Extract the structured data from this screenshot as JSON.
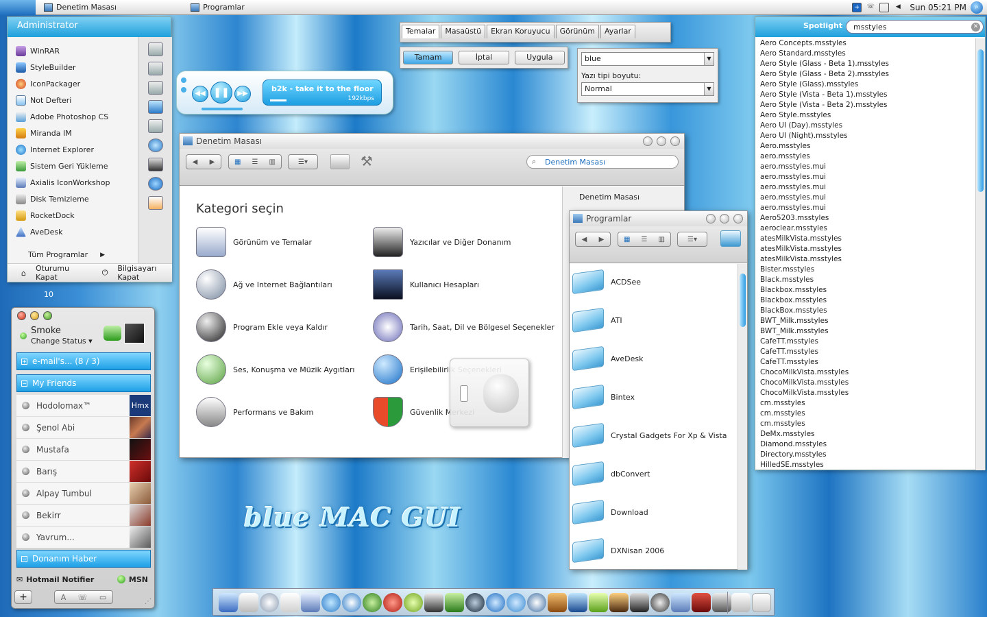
{
  "menubar": {
    "window_items": [
      "Denetim Masası",
      "Programlar"
    ],
    "clock": "Sun 05:21 PM"
  },
  "start_menu": {
    "user": "Administrator",
    "items": [
      "WinRAR",
      "StyleBuilder",
      "IconPackager",
      "Not Defteri",
      "Adobe Photoshop CS",
      "Miranda IM",
      "Internet Explorer",
      "Sistem Geri Yükleme",
      "Axialis IconWorkshop",
      "Disk Temizleme",
      "RocketDock",
      "AveDesk"
    ],
    "all_programs": "Tüm Programlar",
    "logoff": "Oturumu Kapat",
    "shutdown": "Bilgisayarı Kapat",
    "badge": "10"
  },
  "display_dialog": {
    "tabs": [
      "Temalar",
      "Masaüstü",
      "Ekran Koruyucu",
      "Görünüm",
      "Ayarlar"
    ],
    "buttons": [
      "Tamam",
      "İptal",
      "Uygula"
    ],
    "theme_value": "blue",
    "font_size_label": "Yazı tipi boyutu:",
    "font_size_value": "Normal"
  },
  "player": {
    "track": "b2k - take it to the floor",
    "bitrate": "192kbps"
  },
  "control_panel": {
    "title": "Denetim Masası",
    "search_placeholder": "Denetim Masası",
    "heading": "Kategori seçin",
    "side_title": "Denetim Masası",
    "categories": [
      "Görünüm ve Temalar",
      "Yazıcılar ve Diğer Donanım",
      "Ağ ve Internet Bağlantıları",
      "Kullanıcı Hesapları",
      "Program Ekle veya Kaldır",
      "Tarih, Saat, Dil ve Bölgesel Seçenekler",
      "Ses, Konuşma ve Müzik Aygıtları",
      "Erişilebilirlik Seçenekleri",
      "Performans ve Bakım",
      "Güvenlik Merkezi"
    ]
  },
  "programs_window": {
    "title": "Programlar",
    "folders": [
      "ACDSee",
      "ATI",
      "AveDesk",
      "Bintex",
      "Crystal Gadgets For Xp & Vista",
      "dbConvert",
      "Download",
      "DXNisan 2006"
    ]
  },
  "spotlight": {
    "label": "Spotlight",
    "query": "msstyles",
    "results": [
      "Aero Concepts.msstyles",
      "Aero Standard.msstyles",
      "Aero Style (Glass - Beta 1).msstyles",
      "Aero Style (Glass - Beta 2).msstyles",
      "Aero Style (Glass).msstyles",
      "Aero Style (Vista - Beta 1).msstyles",
      "Aero Style (Vista - Beta 2).msstyles",
      "Aero Style.msstyles",
      "Aero UI (Day).msstyles",
      "Aero UI (Night).msstyles",
      "Aero.msstyles",
      "aero.msstyles",
      "aero.msstyles.mui",
      "aero.msstyles.mui",
      "aero.msstyles.mui",
      "aero.msstyles.mui",
      "aero.msstyles.mui",
      "Aero5203.msstyles",
      "aeroclear.msstyles",
      "atesMilkVista.msstyles",
      "atesMilkVista.msstyles",
      "atesMilkVista.msstyles",
      "Bister.msstyles",
      "Black.msstyles",
      "Blackbox.msstyles",
      "Blackbox.msstyles",
      "BlackBox.msstyles",
      "BWT_Milk.msstyles",
      "BWT_Milk.msstyles",
      "CafeTT.msstyles",
      "CafeTT.msstyles",
      "CafeTT.msstyles",
      "ChocoMilkVista.msstyles",
      "ChocoMilkVista.msstyles",
      "ChocoMilkVista.msstyles",
      "cm.msstyles",
      "cm.msstyles",
      "cm.msstyles",
      "DeMx.msstyles",
      "Diamond.msstyles",
      "Directory.msstyles",
      "HilledSE.msstyles"
    ]
  },
  "msn": {
    "user": "Smoke",
    "status": "Change Status",
    "groups": [
      "e-mail's... (8 / 3)",
      "My Friends",
      "Donanım Haber"
    ],
    "friends": [
      "Hodolomax™",
      "Şenol Abi",
      "Mustafa",
      "Barış",
      "Alpay Tumbul",
      "Bekirr",
      "Yavrum..."
    ],
    "avatar_text": "Hmx",
    "notifier": "Hotmail Notifier",
    "network": "MSN"
  },
  "branding": "blue MAC GUI",
  "colors": {
    "accent": "#1ea0dc",
    "accent_light": "#7fd0f2"
  }
}
